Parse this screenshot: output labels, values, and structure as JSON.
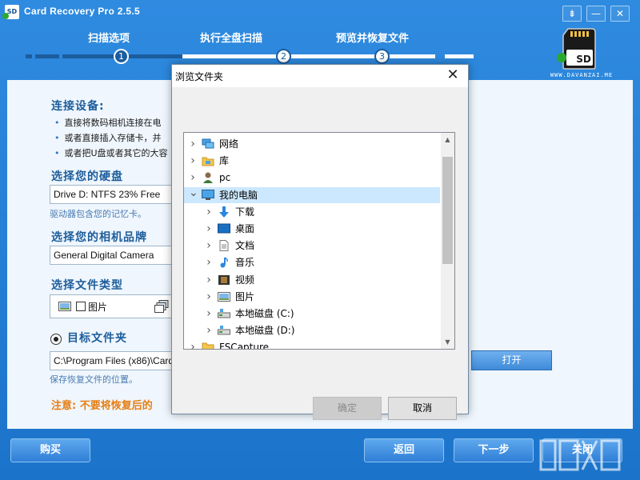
{
  "app": {
    "title": "Card Recovery Pro 2.5.5",
    "icon_label": "SD",
    "window_buttons": [
      "⇟",
      "—",
      "✕"
    ]
  },
  "steps": {
    "items": [
      {
        "label": "扫描选项",
        "number": "1"
      },
      {
        "label": "执行全盘扫描",
        "number": "2"
      },
      {
        "label": "预览并恢复文件",
        "number": "3"
      }
    ],
    "current": 1
  },
  "brand": {
    "logo_card_text": "SD",
    "logo_site": "WWW.DAVANZAI.ME"
  },
  "panel": {
    "connect": {
      "title": "连接设备:",
      "bullets": [
        "直接将数码相机连接在电",
        "或者直接插入存储卡，并",
        "或者把U盘或者其它的大容"
      ]
    },
    "disk": {
      "title": "选择您的硬盘",
      "value": "Drive D: NTFS 23% Free",
      "hint": "驱动器包含您的记忆卡。"
    },
    "camera": {
      "title": "选择您的相机品牌",
      "value": "General Digital Camera"
    },
    "filetype": {
      "title": "选择文件类型",
      "image_label": "图片"
    },
    "target": {
      "title": "目标文件夹",
      "value": "C:\\Program Files (x86)\\Card",
      "hint": "保存恢复文件的位置。"
    },
    "note": "注意: 不要将恢复后的",
    "open_button": "打开"
  },
  "footer": {
    "buy": "购买",
    "back": "返回",
    "next": "下一步",
    "close": "关闭"
  },
  "dialog": {
    "title": "浏览文件夹",
    "tree": [
      {
        "label": "网络",
        "icon": "network-icon",
        "level": 0,
        "expanded": false
      },
      {
        "label": "库",
        "icon": "library-icon",
        "level": 0,
        "expanded": false
      },
      {
        "label": "pc",
        "icon": "user-icon",
        "level": 0,
        "expanded": false
      },
      {
        "label": "我的电脑",
        "icon": "computer-icon",
        "level": 0,
        "expanded": true,
        "selected": true
      },
      {
        "label": "下载",
        "icon": "download-icon",
        "level": 1,
        "expanded": false
      },
      {
        "label": "桌面",
        "icon": "desktop-icon",
        "level": 1,
        "expanded": false
      },
      {
        "label": "文档",
        "icon": "document-icon",
        "level": 1,
        "expanded": false
      },
      {
        "label": "音乐",
        "icon": "music-icon",
        "level": 1,
        "expanded": false
      },
      {
        "label": "视频",
        "icon": "video-icon",
        "level": 1,
        "expanded": false
      },
      {
        "label": "图片",
        "icon": "picture-icon",
        "level": 1,
        "expanded": false
      },
      {
        "label": "本地磁盘 (C:)",
        "icon": "drive-icon",
        "level": 1,
        "expanded": false
      },
      {
        "label": "本地磁盘 (D:)",
        "icon": "drive-icon",
        "level": 1,
        "expanded": false
      },
      {
        "label": "FSCapture",
        "icon": "folder-icon",
        "level": 0,
        "expanded": false
      }
    ],
    "ok": "确定",
    "cancel": "取消"
  },
  "colors": {
    "accent": "#1c74ca",
    "note": "#e67e14",
    "step_done": "#1c5d9e",
    "selection": "#cce8ff"
  }
}
